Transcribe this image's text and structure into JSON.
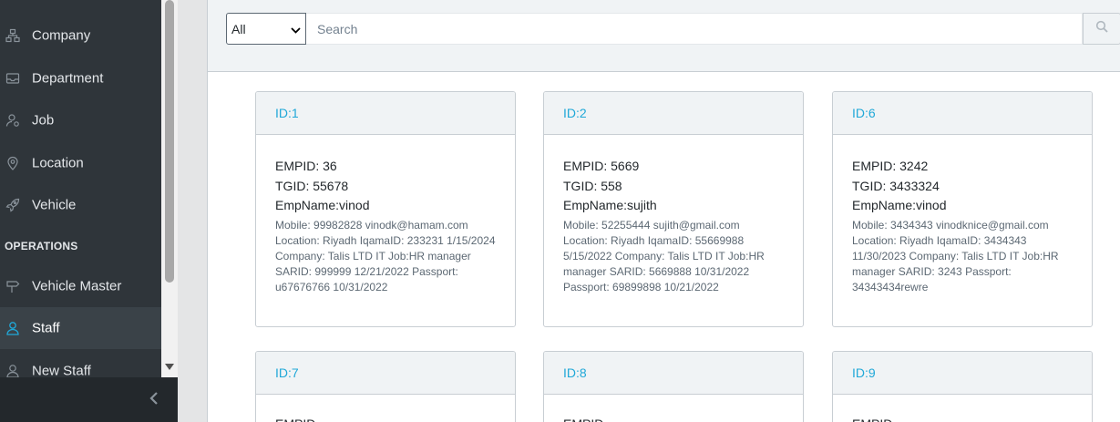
{
  "sidebar": {
    "items": [
      {
        "label": "Company",
        "icon": "sitemap-icon"
      },
      {
        "label": "Department",
        "icon": "inbox-icon"
      },
      {
        "label": "Job",
        "icon": "user-badge-icon"
      },
      {
        "label": "Location",
        "icon": "location-pin-icon"
      },
      {
        "label": "Vehicle",
        "icon": "rocket-icon"
      }
    ],
    "section_title": "OPERATIONS",
    "ops_items": [
      {
        "label": "Vehicle Master",
        "icon": "signpost-icon"
      },
      {
        "label": "Staff",
        "icon": "user-icon",
        "active": true
      },
      {
        "label": "New Staff",
        "icon": "user-icon"
      }
    ]
  },
  "search": {
    "filter_value": "All",
    "placeholder": "Search"
  },
  "cards": [
    {
      "header": "ID:1",
      "empid": "EMPID: 36",
      "tgid": "TGID: 55678",
      "empname": "EmpName:vinod",
      "details": "Mobile: 99982828 vinodk@hamam.com Location: Riyadh IqamaID: 233231 1/15/2024 Company: Talis LTD IT Job:HR manager SARID: 999999 12/21/2022 Passport: u67676766 10/31/2022"
    },
    {
      "header": "ID:2",
      "empid": "EMPID: 5669",
      "tgid": "TGID: 558",
      "empname": "EmpName:sujith",
      "details": "Mobile: 52255444 sujith@gmail.com Location: Riyadh IqamaID: 55669988 5/15/2022 Company: Talis LTD IT Job:HR manager SARID: 5669888 10/31/2022 Passport: 69899898 10/21/2022"
    },
    {
      "header": "ID:6",
      "empid": "EMPID: 3242",
      "tgid": "TGID: 3433324",
      "empname": "EmpName:vinod",
      "details": "Mobile: 3434343 vinodknice@gmail.com Location: Riyadh IqamaID: 3434343 11/30/2023 Company: Talis LTD IT Job:HR manager SARID: 3243 Passport: 34343434rewre"
    },
    {
      "header": "ID:7",
      "empid": "EMPID",
      "tgid": "",
      "empname": "",
      "details": ""
    },
    {
      "header": "ID:8",
      "empid": "EMPID",
      "tgid": "",
      "empname": "",
      "details": ""
    },
    {
      "header": "ID:9",
      "empid": "EMPID",
      "tgid": "",
      "empname": "",
      "details": ""
    }
  ],
  "colors": {
    "sidebar_bg": "#2f353a",
    "accent": "#20a8d8",
    "card_header_bg": "#f0f3f5"
  }
}
